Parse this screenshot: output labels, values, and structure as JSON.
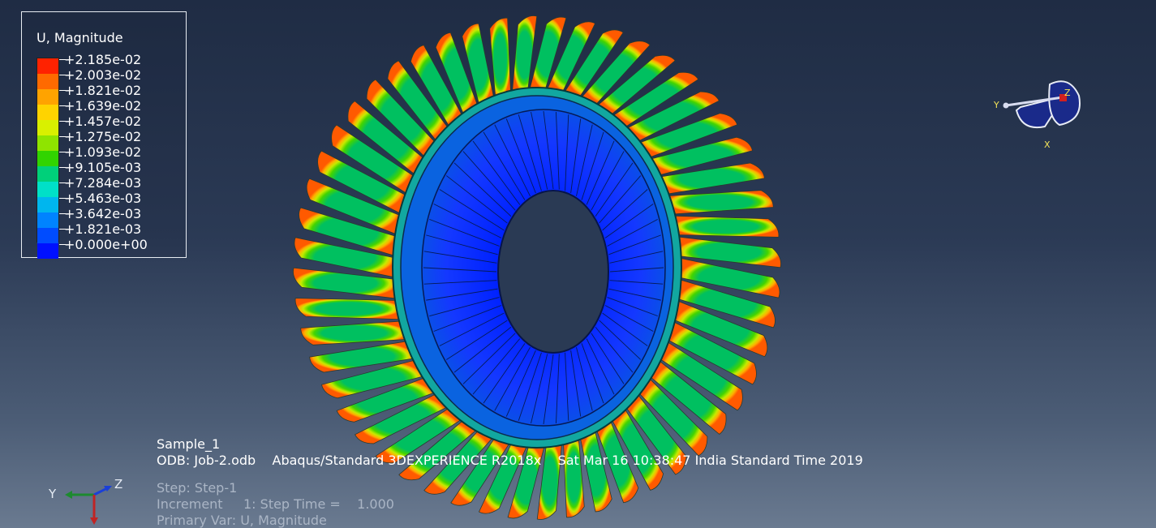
{
  "legend": {
    "title": "U, Magnitude",
    "values": [
      "+2.185e-02",
      "+2.003e-02",
      "+1.821e-02",
      "+1.639e-02",
      "+1.457e-02",
      "+1.275e-02",
      "+1.093e-02",
      "+9.105e-03",
      "+7.284e-03",
      "+5.463e-03",
      "+3.642e-03",
      "+1.821e-03",
      "+0.000e+00"
    ],
    "colors": [
      "#ff2200",
      "#ff6a00",
      "#ffa300",
      "#ffd300",
      "#d9f000",
      "#8fe400",
      "#31d400",
      "#00d07a",
      "#00e0c8",
      "#00b6ee",
      "#0083ff",
      "#004cff",
      "#0010ff"
    ]
  },
  "info": {
    "model_name": "Sample_1",
    "odb_line": "ODB: Job-2.odb    Abaqus/Standard 3DEXPERIENCE R2018x    Sat Mar 16 10:38:47 India Standard Time 2019",
    "step_line": "Step: Step-1",
    "increment_line": "Increment     1: Step Time =    1.000",
    "primary_var_line": "Primary Var: U, Magnitude"
  },
  "triad": {
    "y_label": "Y",
    "z_label": "Z",
    "x_color": "#c02424",
    "y_color": "#1d8a2f",
    "z_color": "#1a3fd8"
  },
  "view_cube": {
    "y_label": "Y",
    "z_label": "Z",
    "x_label": "X"
  }
}
